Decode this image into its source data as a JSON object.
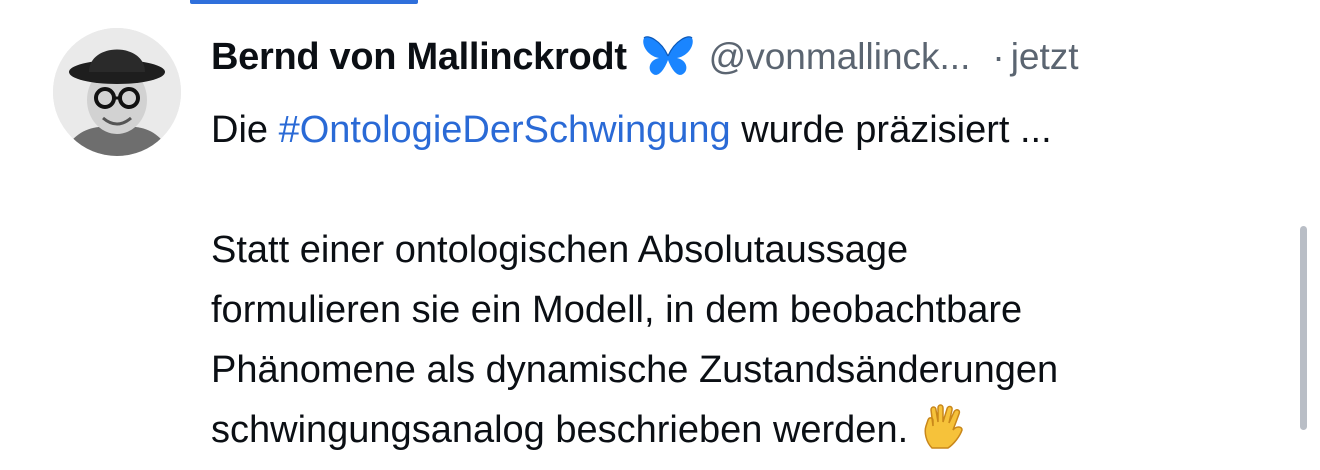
{
  "post": {
    "author": {
      "display_name": "Bernd von Mallinckrodt",
      "handle": "@vonmallinck...",
      "badge_icon": "butterfly-icon",
      "avatar": "avatar-photo"
    },
    "separator": "·",
    "timestamp": "jetzt",
    "text": {
      "line1_prefix": "Die",
      "hashtag": "#OntologieDerSchwingung",
      "line1_suffix": "wurde präzisiert ...",
      "line2": "Statt einer ontologischen Absolutaussage",
      "line3": "formulieren sie ein Modell, in dem beobachtbare",
      "line4": "Phänomene als dynamische Zustandsänderungen",
      "line5": "schwingungsanalog beschrieben werden.",
      "trailing_emoji": "vulcan-salute-icon"
    }
  },
  "colors": {
    "hashtag": "#2a6ad6",
    "meta_text": "#5b6571",
    "tab_indicator": "#2f6fdb",
    "butterfly": "#1a85ff"
  }
}
